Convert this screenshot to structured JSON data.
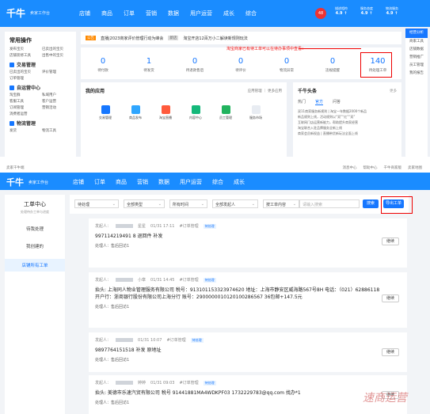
{
  "top": {
    "logo": "千牛",
    "logo_sub": "卖家工作台",
    "menu": [
      "店铺",
      "商品",
      "订单",
      "营销",
      "数据",
      "用户运营",
      "成长",
      "综合"
    ],
    "avatar": "48",
    "scores": [
      {
        "label": "描述相符",
        "value": "4.9 ↑"
      },
      {
        "label": "服务态度",
        "value": "4.9 ↑"
      },
      {
        "label": "物流服务",
        "value": "4.9 ↑"
      }
    ],
    "sidebar": {
      "title": "常用操作",
      "quick": [
        "发布宝贝",
        "已卖出的宝贝",
        "店铺装修工具",
        "出售中的宝贝"
      ],
      "sections": [
        {
          "name": "交易管理",
          "items": [
            "已卖出的宝贝",
            "评价管理",
            "订单管理"
          ]
        },
        {
          "name": "自运营中心",
          "items": [
            "淘宝群",
            "私域用户",
            "客服工具",
            "客户运营",
            "订阅管理",
            "营销活动",
            "消费者运营"
          ]
        },
        {
          "name": "物流管理",
          "items": [
            "发货",
            "物流工具"
          ]
        }
      ]
    },
    "notice": {
      "tag": "公告",
      "text": "直播|2023商家评价管理行动为峰会",
      "tag2": "新店",
      "text2": "淘宝开店12百万小二解读新规则玩法"
    },
    "hint": "淘宝商家已有待工单可以在待办事项中查看：",
    "stats": [
      {
        "n": "0",
        "l": "待付款"
      },
      {
        "n": "1",
        "l": "待发货"
      },
      {
        "n": "0",
        "l": "待退款售后"
      },
      {
        "n": "0",
        "l": "待评价"
      },
      {
        "n": "0",
        "l": "物流异常"
      },
      {
        "n": "0",
        "l": "违规提醒"
      },
      {
        "n": "140",
        "l": "待处理工单"
      }
    ],
    "apps": {
      "title": "我的应用",
      "links": "应用管理 ｜ 更多应用",
      "items": [
        "交易管理",
        "商品发布",
        "淘宝直播",
        "内容中心",
        "员工管理",
        "服务市场"
      ]
    },
    "news": {
      "title": "千牛头条",
      "more": "更多",
      "tabs": [
        "热门",
        "官方",
        "问答"
      ],
      "lines": [
        "双11商家服务新规则 | 淘宝一年数据2000个新品",
        "新品规则上线，活动规则以“双”“红”“双”",
        "互联网门店运营新能力，帮助提升商家经营",
        "淘宝联合入驻品牌服务全新上线",
        "商家会员新权益 | 直播带货新玩法全面上线"
      ]
    },
    "right_bar": [
      "经营分析",
      "商家工具",
      "店铺数据",
      "营销推广",
      "员工管理",
      "我的报告"
    ]
  },
  "bottom": {
    "strip_left": "卖家千牛端",
    "strip_right": [
      "消息中心",
      "帮助中心",
      "千牛商家版",
      "卖家地图"
    ],
    "logo": "千牛",
    "logo_sub": "卖家工作台",
    "menu": [
      "店铺",
      "订单",
      "商品",
      "营销",
      "数据",
      "用户运营",
      "综合",
      "成长"
    ],
    "sidebar": {
      "title": "工单中心",
      "subtitle": "处理待办工单与进度",
      "items": [
        "待我处理",
        "我创建的",
        "店铺所有工单"
      ],
      "selected": "店铺所有工单"
    },
    "filters": [
      "待处理",
      "全部类型",
      "所有时间",
      "全部发起人",
      "按工单内容"
    ],
    "search_placeholder": "请输入搜索",
    "search_btn": "搜索",
    "export_btn": "导出工单",
    "cards": [
      {
        "prefix": "发起人：",
        "suffix": "星星",
        "time": "01/31 17:11",
        "type": "#订单管理",
        "badge": "待处理",
        "body": "997114219491 8 退回件 补发",
        "handler": "处理人：售后回访1",
        "button": "继续"
      },
      {
        "prefix": "发起人：",
        "suffix": "小章",
        "time": "01/31 14:45",
        "type": "#订单管理",
        "badge": "待处理",
        "body": "抬头: 上海同人物业管理服务有限公司 税号：913101153323974620 地址：上海市静安区威海路567号8H 电话：（021）62886118",
        "body2": "开户行：浙商银行股份有限公司上海分行 账号：2900000010120100286567 36包邮+147.5元",
        "handler": "处理人：售后回访1",
        "button": "继续"
      },
      {
        "prefix": "发起人：",
        "suffix": "",
        "time": "01/31 10:07",
        "type": "#订单管理",
        "badge": "待处理",
        "body": "9897764151518 补发 原地址",
        "handler": "处理人：售后回访1",
        "button": "继续"
      },
      {
        "prefix": "发起人：",
        "suffix": "婷婷",
        "time": "01/31 09:03",
        "type": "#订单管理",
        "badge": "待处理",
        "body": "抬头: 美德市乐速汽贸有限公司 税号 91441881MA4WDKPF03 1732229783@qq.com 找办*1",
        "handler": "处理人：售后回访1",
        "button": "继续"
      }
    ],
    "watermark": "速商运营"
  }
}
